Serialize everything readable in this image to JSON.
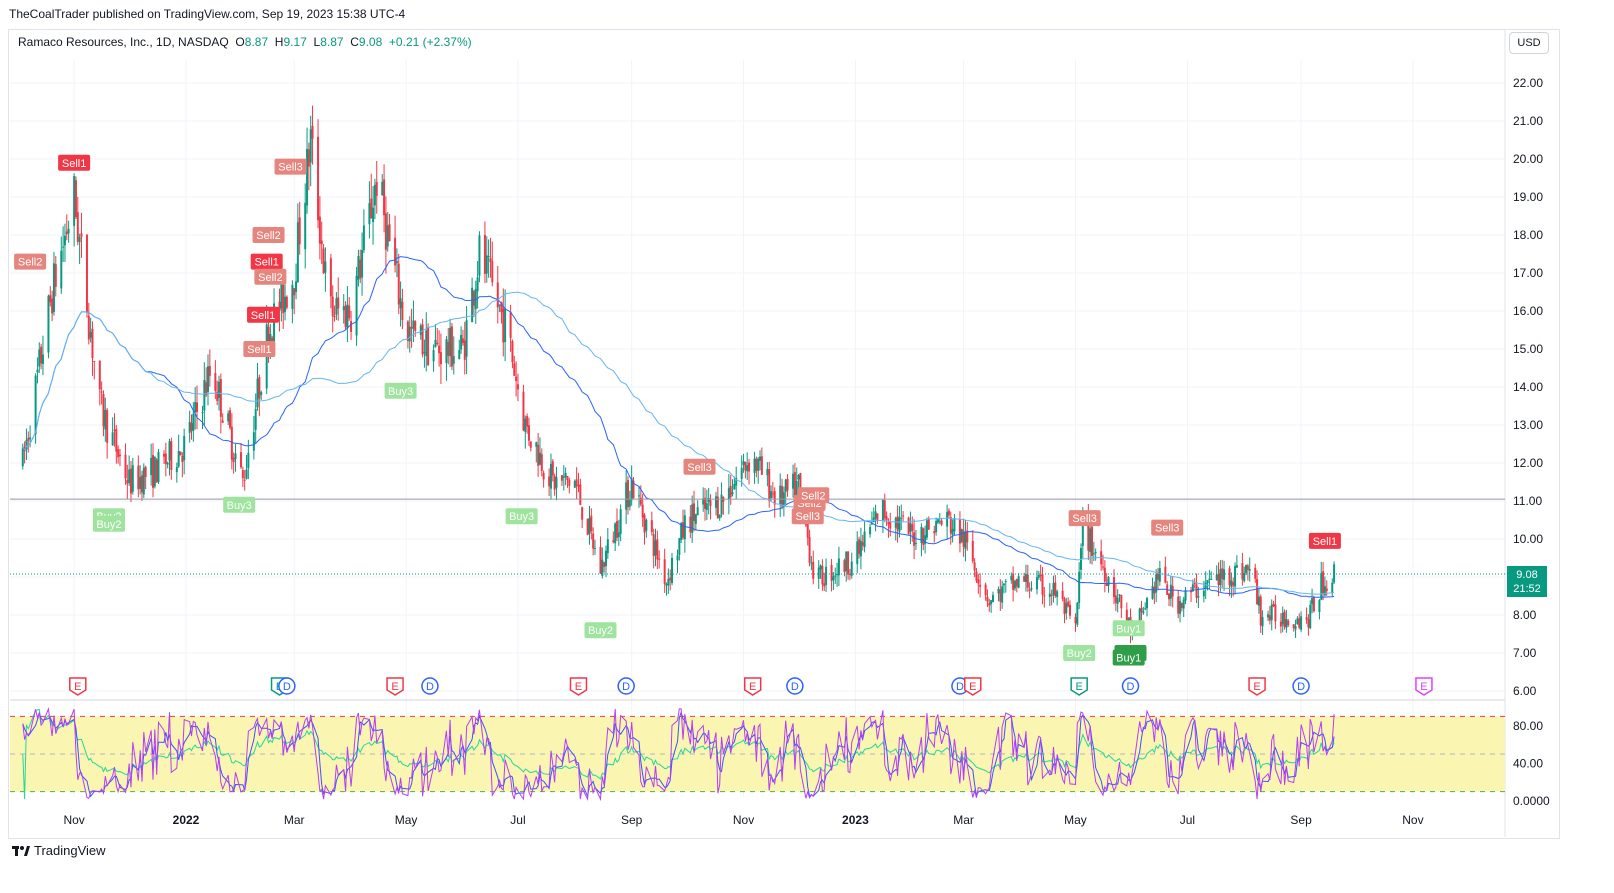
{
  "publisher_line": "TheCoalTrader published on TradingView.com, Sep 19, 2023 15:38 UTC-4",
  "legend": {
    "symbol": "Ramaco Resources, Inc., 1D, NASDAQ",
    "open_label": "O",
    "open": "8.87",
    "high_label": "H",
    "high": "9.17",
    "low_label": "L",
    "low": "8.87",
    "close_label": "C",
    "close": "9.08",
    "change": "+0.21 (+2.37%)"
  },
  "currency_button": "USD",
  "price_tag": {
    "price": "9.08",
    "countdown": "21:52"
  },
  "footer": {
    "brand": "TradingView"
  },
  "colors": {
    "up": "#089981",
    "down": "#f23645",
    "ma_fast": "#2962ff",
    "ma_slow": "#64b5f6",
    "stoch_k": "#b63ef5",
    "stoch_d": "#3f51ff",
    "rsi": "#26d6a0",
    "band_fill": "#faf5b0"
  },
  "chart_data": {
    "type": "candlestick",
    "title": "Ramaco Resources, Inc., 1D, NASDAQ",
    "y_ticks": [
      "22.00",
      "21.00",
      "20.00",
      "19.00",
      "18.00",
      "17.00",
      "16.00",
      "15.00",
      "14.00",
      "13.00",
      "12.00",
      "11.00",
      "10.00",
      "9.00",
      "8.00",
      "7.00",
      "6.00"
    ],
    "ylim": [
      6,
      22
    ],
    "x_ticks": [
      {
        "label": "Nov",
        "date": "2021-11-01"
      },
      {
        "label": "2022",
        "date": "2022-01-01"
      },
      {
        "label": "Mar",
        "date": "2022-03-01"
      },
      {
        "label": "May",
        "date": "2022-05-01"
      },
      {
        "label": "Jul",
        "date": "2022-07-01"
      },
      {
        "label": "Sep",
        "date": "2022-09-01"
      },
      {
        "label": "Nov",
        "date": "2022-11-01"
      },
      {
        "label": "2023",
        "date": "2023-01-01"
      },
      {
        "label": "Mar",
        "date": "2023-03-01"
      },
      {
        "label": "May",
        "date": "2023-05-01"
      },
      {
        "label": "Jul",
        "date": "2023-07-01"
      },
      {
        "label": "Sep",
        "date": "2023-09-01"
      },
      {
        "label": "Nov",
        "date": "2023-11-01"
      }
    ],
    "close_path": [
      [
        "2021-10-04",
        12.0
      ],
      [
        "2021-10-20",
        16.5
      ],
      [
        "2021-11-01",
        19.0
      ],
      [
        "2021-11-15",
        13.5
      ],
      [
        "2021-12-01",
        11.5
      ],
      [
        "2021-12-15",
        11.8
      ],
      [
        "2022-01-01",
        12.5
      ],
      [
        "2022-01-15",
        14.5
      ],
      [
        "2022-02-01",
        11.5
      ],
      [
        "2022-02-15",
        15.5
      ],
      [
        "2022-03-01",
        17.0
      ],
      [
        "2022-03-10",
        20.5
      ],
      [
        "2022-03-20",
        16.0
      ],
      [
        "2022-04-01",
        16.0
      ],
      [
        "2022-04-15",
        19.5
      ],
      [
        "2022-05-01",
        15.5
      ],
      [
        "2022-05-15",
        15.0
      ],
      [
        "2022-06-01",
        15.0
      ],
      [
        "2022-06-10",
        17.5
      ],
      [
        "2022-06-25",
        15.5
      ],
      [
        "2022-07-05",
        13.0
      ],
      [
        "2022-07-20",
        11.5
      ],
      [
        "2022-08-01",
        11.5
      ],
      [
        "2022-08-15",
        9.2
      ],
      [
        "2022-09-01",
        11.5
      ],
      [
        "2022-09-20",
        8.9
      ],
      [
        "2022-10-01",
        10.5
      ],
      [
        "2022-10-20",
        11.0
      ],
      [
        "2022-11-05",
        12.2
      ],
      [
        "2022-11-20",
        11.0
      ],
      [
        "2022-12-01",
        11.4
      ],
      [
        "2022-12-10",
        8.9
      ],
      [
        "2023-01-01",
        9.5
      ],
      [
        "2023-01-15",
        10.8
      ],
      [
        "2023-02-01",
        10.1
      ],
      [
        "2023-02-20",
        10.5
      ],
      [
        "2023-03-01",
        10.0
      ],
      [
        "2023-03-15",
        8.4
      ],
      [
        "2023-04-01",
        8.9
      ],
      [
        "2023-04-20",
        8.6
      ],
      [
        "2023-05-01",
        7.6
      ],
      [
        "2023-05-05",
        10.3
      ],
      [
        "2023-05-20",
        8.9
      ],
      [
        "2023-06-01",
        7.5
      ],
      [
        "2023-06-15",
        9.0
      ],
      [
        "2023-06-25",
        8.3
      ],
      [
        "2023-07-10",
        8.8
      ],
      [
        "2023-07-25",
        9.1
      ],
      [
        "2023-08-05",
        9.2
      ],
      [
        "2023-08-10",
        8.0
      ],
      [
        "2023-09-05",
        7.9
      ],
      [
        "2023-09-12",
        8.8
      ],
      [
        "2023-09-19",
        9.08
      ]
    ],
    "last_bar": {
      "open": 8.87,
      "high": 9.17,
      "low": 8.87,
      "close": 9.08
    },
    "series": [
      {
        "name": "SMA 50",
        "type": "line"
      },
      {
        "name": "SMA 100",
        "type": "line"
      }
    ],
    "horizontal_line": 11.05,
    "signals": [
      {
        "label": "Sell2",
        "date": "2021-10-08",
        "price": 17.3,
        "kind": "sell-soft"
      },
      {
        "label": "Sell1",
        "date": "2021-11-01",
        "price": 19.9,
        "kind": "sell"
      },
      {
        "label": "Buy2",
        "date": "2021-11-20",
        "price": 10.6,
        "kind": "buy-soft"
      },
      {
        "label": "Buy2",
        "date": "2021-11-20",
        "price": 10.4,
        "kind": "buy-soft"
      },
      {
        "label": "Buy3",
        "date": "2022-01-30",
        "price": 10.9,
        "kind": "buy-soft"
      },
      {
        "label": "Sell1",
        "date": "2022-02-10",
        "price": 15.0,
        "kind": "sell-soft"
      },
      {
        "label": "Sell1",
        "date": "2022-02-12",
        "price": 15.9,
        "kind": "sell"
      },
      {
        "label": "Sell1",
        "date": "2022-02-14",
        "price": 17.3,
        "kind": "sell"
      },
      {
        "label": "Sell2",
        "date": "2022-02-16",
        "price": 16.9,
        "kind": "sell-soft"
      },
      {
        "label": "Sell2",
        "date": "2022-02-15",
        "price": 18.0,
        "kind": "sell-soft"
      },
      {
        "label": "Sell3",
        "date": "2022-02-27",
        "price": 19.8,
        "kind": "sell-soft"
      },
      {
        "label": "Buy3",
        "date": "2022-04-28",
        "price": 13.9,
        "kind": "buy-soft"
      },
      {
        "label": "Buy3",
        "date": "2022-07-03",
        "price": 10.6,
        "kind": "buy-soft"
      },
      {
        "label": "Buy2",
        "date": "2022-08-15",
        "price": 7.6,
        "kind": "buy-soft"
      },
      {
        "label": "Sell3",
        "date": "2022-10-08",
        "price": 11.9,
        "kind": "sell-soft"
      },
      {
        "label": "Sell3",
        "date": "2022-12-06",
        "price": 10.6,
        "kind": "sell-soft"
      },
      {
        "label": "Sell2",
        "date": "2022-12-07",
        "price": 10.95,
        "kind": "sell-soft"
      },
      {
        "label": "Sell2",
        "date": "2022-12-09",
        "price": 11.15,
        "kind": "sell-soft"
      },
      {
        "label": "Sell3",
        "date": "2023-05-06",
        "price": 10.55,
        "kind": "sell-soft"
      },
      {
        "label": "Buy2",
        "date": "2023-05-03",
        "price": 7.0,
        "kind": "buy-soft"
      },
      {
        "label": "Buy1",
        "date": "2023-05-30",
        "price": 7.65,
        "kind": "buy-soft"
      },
      {
        "label": "Buy1",
        "date": "2023-05-31",
        "price": 7.0,
        "kind": "buy"
      },
      {
        "label": "Buy1",
        "date": "2023-05-30",
        "price": 6.88,
        "kind": "buy"
      },
      {
        "label": "Sell3",
        "date": "2023-06-20",
        "price": 10.3,
        "kind": "sell-soft"
      },
      {
        "label": "Sell1",
        "date": "2023-09-14",
        "price": 9.95,
        "kind": "sell"
      }
    ],
    "events": [
      {
        "type": "E",
        "date": "2021-11-03",
        "color": "#f23645"
      },
      {
        "type": "E",
        "date": "2022-02-21",
        "color": "#089981"
      },
      {
        "type": "D",
        "date": "2022-02-25",
        "color": "#2962ff"
      },
      {
        "type": "E",
        "date": "2022-04-25",
        "color": "#f23645"
      },
      {
        "type": "D",
        "date": "2022-05-14",
        "color": "#2962ff"
      },
      {
        "type": "E",
        "date": "2022-08-03",
        "color": "#f23645"
      },
      {
        "type": "D",
        "date": "2022-08-29",
        "color": "#2962ff"
      },
      {
        "type": "E",
        "date": "2022-11-06",
        "color": "#f23645"
      },
      {
        "type": "D",
        "date": "2022-11-29",
        "color": "#2962ff"
      },
      {
        "type": "D",
        "date": "2023-02-27",
        "color": "#2962ff"
      },
      {
        "type": "E",
        "date": "2023-03-06",
        "color": "#f23645"
      },
      {
        "type": "E",
        "date": "2023-05-03",
        "color": "#089981"
      },
      {
        "type": "D",
        "date": "2023-05-31",
        "color": "#2962ff"
      },
      {
        "type": "E",
        "date": "2023-08-08",
        "color": "#f23645"
      },
      {
        "type": "D",
        "date": "2023-09-01",
        "color": "#2962ff"
      },
      {
        "type": "E",
        "date": "2023-11-07",
        "color": "#e040fb"
      }
    ],
    "oscillator": {
      "y_ticks": [
        "80.00",
        "40.00",
        "0.0000"
      ],
      "ylim": [
        0,
        100
      ],
      "upper_band": 90,
      "middle": 50,
      "lower_band": 10
    }
  }
}
